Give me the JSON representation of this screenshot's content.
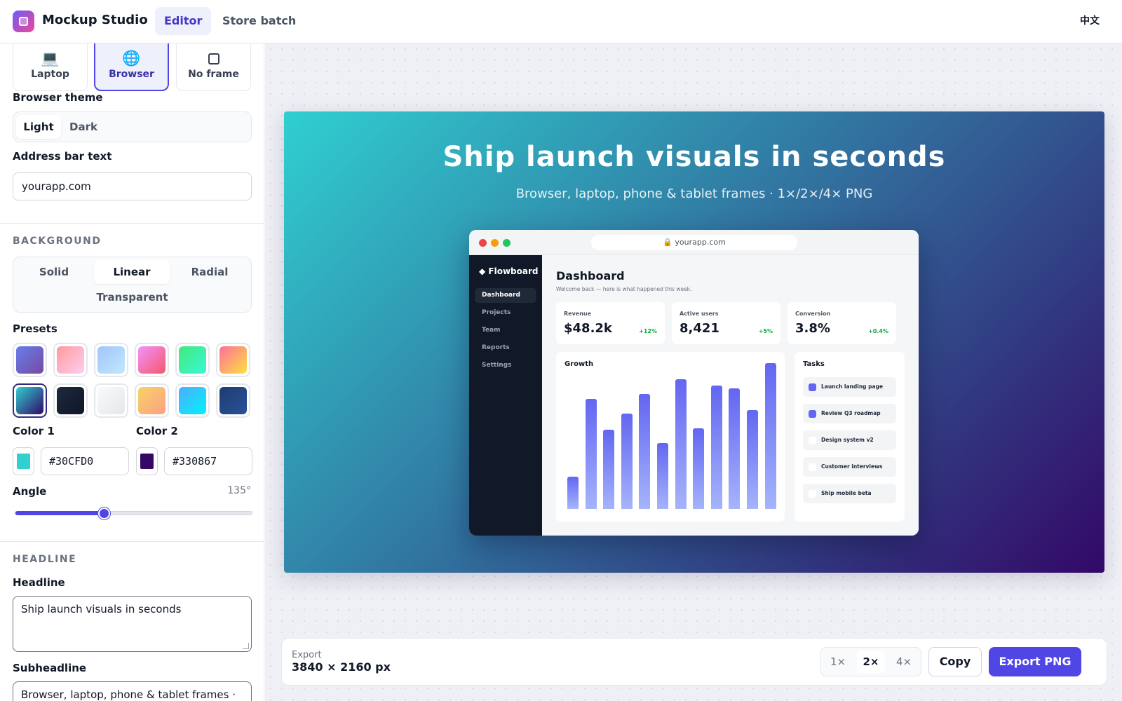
{
  "app": {
    "title": "Mockup Studio",
    "language_toggle": "中文"
  },
  "nav": {
    "tabs": [
      {
        "label": "Editor",
        "active": true
      },
      {
        "label": "Store batch",
        "active": false
      }
    ]
  },
  "frame": {
    "options": [
      {
        "label": "Laptop",
        "icon": "laptop-icon",
        "glyph": "💻"
      },
      {
        "label": "Browser",
        "icon": "globe-icon",
        "glyph": "🌐",
        "selected": true
      },
      {
        "label": "No frame",
        "icon": "square-icon"
      }
    ]
  },
  "browser_theme": {
    "label": "Browser theme",
    "options": [
      "Light",
      "Dark"
    ],
    "selected": "Light"
  },
  "address_bar": {
    "label": "Address bar text",
    "value": "yourapp.com"
  },
  "background": {
    "section_label": "BACKGROUND",
    "types": [
      "Solid",
      "Linear",
      "Radial",
      "Transparent"
    ],
    "selected_type": "Linear",
    "presets_label": "Presets",
    "presets": [
      [
        "#667eea",
        "#764ba2"
      ],
      [
        "#ff9a9e",
        "#fecfef"
      ],
      [
        "#a1c4fd",
        "#c2e9fb"
      ],
      [
        "#f093fb",
        "#f5576c"
      ],
      [
        "#43e97b",
        "#38f9d7"
      ],
      [
        "#fa709a",
        "#fee140"
      ],
      [
        "#30CFD0",
        "#330867"
      ],
      [
        "#1e293b",
        "#0f172a"
      ],
      [
        "#f8fafc",
        "#e5e7eb"
      ],
      [
        "#f6d365",
        "#fda085"
      ],
      [
        "#4facfe",
        "#00f2fe"
      ],
      [
        "#1e3c72",
        "#2a5298"
      ]
    ],
    "selected_preset": 6,
    "color1_label": "Color 1",
    "color1": "#30CFD0",
    "color2_label": "Color 2",
    "color2": "#330867",
    "angle_label": "Angle",
    "angle_display": "135°",
    "angle_fraction": 0.375
  },
  "headline_section": {
    "section_label": "HEADLINE",
    "headline_label": "Headline",
    "headline_value": "Ship launch visuals in seconds",
    "subheadline_label": "Subheadline",
    "subheadline_value": "Browser, laptop, phone & tablet frames ·"
  },
  "preview": {
    "headline": "Ship launch visuals in seconds",
    "subheadline": "Browser, laptop, phone & tablet frames · 1×/2×/4× PNG",
    "url": "🔒 yourapp.com",
    "window_dots": [
      "#ef4444",
      "#f59e0b",
      "#22c55e"
    ],
    "app": {
      "brand": "◆ Flowboard",
      "nav": [
        {
          "label": "Dashboard",
          "active": true
        },
        {
          "label": "Projects"
        },
        {
          "label": "Team"
        },
        {
          "label": "Reports"
        },
        {
          "label": "Settings"
        }
      ],
      "title": "Dashboard",
      "welcome": "Welcome back — here is what happened this week.",
      "stats": [
        {
          "label": "Revenue",
          "value": "$48.2k",
          "delta": "+12%"
        },
        {
          "label": "Active users",
          "value": "8,421",
          "delta": "+5%"
        },
        {
          "label": "Conversion",
          "value": "3.8%",
          "delta": "+0.4%"
        }
      ],
      "growth_title": "Growth",
      "growth_values": [
        22,
        75,
        54,
        65,
        78,
        45,
        88,
        55,
        84,
        82,
        67,
        99
      ],
      "tasks_title": "Tasks",
      "tasks": [
        {
          "label": "Launch landing page",
          "done": true
        },
        {
          "label": "Review Q3 roadmap",
          "done": true
        },
        {
          "label": "Design system v2",
          "done": false
        },
        {
          "label": "Customer interviews",
          "done": false
        },
        {
          "label": "Ship mobile beta",
          "done": false
        }
      ]
    }
  },
  "export": {
    "label": "Export",
    "size": "3840 × 2160 px",
    "scales": [
      "1×",
      "2×",
      "4×"
    ],
    "selected_scale": "2×",
    "copy_label": "Copy",
    "export_label": "Export PNG"
  }
}
